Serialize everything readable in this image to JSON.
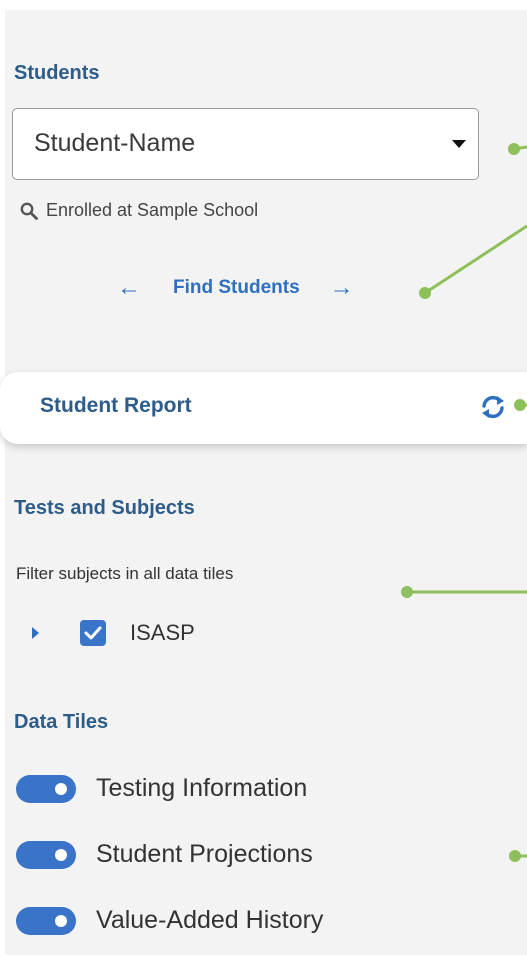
{
  "students_section": {
    "title": "Students",
    "selected_student": "Student-Name",
    "enrolled_text": "Enrolled at Sample School",
    "find_students_label": "Find Students",
    "prev_icon": "arrow-left-icon",
    "next_icon": "arrow-right-icon"
  },
  "report": {
    "label": "Student Report",
    "refresh_icon": "refresh-icon"
  },
  "tests_section": {
    "title": "Tests and Subjects",
    "filter_text": "Filter subjects in all data tiles",
    "subjects": [
      {
        "label": "ISASP",
        "checked": true
      }
    ]
  },
  "tiles_section": {
    "title": "Data Tiles",
    "tiles": [
      {
        "label": "Testing Information",
        "enabled": true
      },
      {
        "label": "Student Projections",
        "enabled": true
      },
      {
        "label": "Value-Added History",
        "enabled": true
      }
    ]
  },
  "colors": {
    "heading": "#2e5c8a",
    "accent": "#3a74c8",
    "callout": "#8dc05a",
    "panel_bg": "#f3f3f3"
  }
}
